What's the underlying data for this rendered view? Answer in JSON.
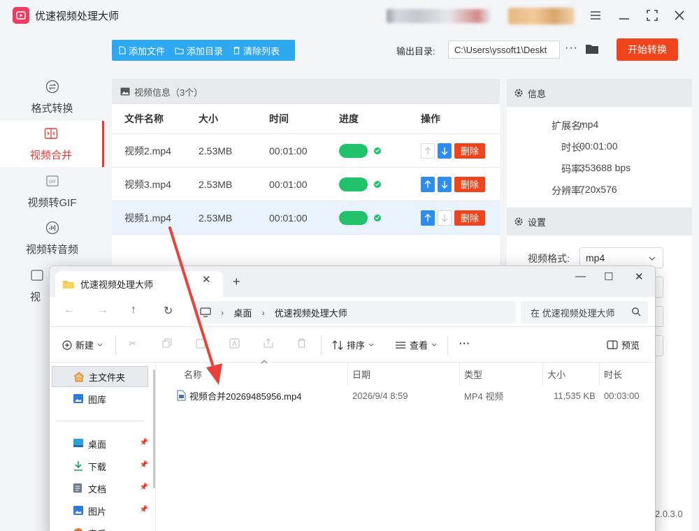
{
  "app": {
    "title": "优速视频处理大师",
    "version": "2.0.3.0"
  },
  "sidebar": {
    "items": [
      {
        "label": "格式转换",
        "icon": "format-convert-icon"
      },
      {
        "label": "视频合并",
        "icon": "video-merge-icon",
        "active": true
      },
      {
        "label": "视频转GIF",
        "icon": "gif-icon"
      },
      {
        "label": "视频转音频",
        "icon": "audio-icon"
      },
      {
        "label": "视",
        "icon": "video-icon"
      }
    ]
  },
  "toolbar": {
    "add_file": "添加文件",
    "add_dir": "添加目录",
    "clear_list": "清除列表",
    "output_label": "输出目录:",
    "output_path": "C:\\Users\\yssoft1\\Deskt",
    "more": "···",
    "start": "开始转换"
  },
  "file_panel": {
    "title": "视频信息（3个）",
    "columns": [
      "文件名称",
      "大小",
      "时间",
      "进度",
      "操作"
    ],
    "rows": [
      {
        "name": "视频2.mp4",
        "size": "2.53MB",
        "time": "00:01:00",
        "progress": 1.0,
        "delete": "删除"
      },
      {
        "name": "视频3.mp4",
        "size": "2.53MB",
        "time": "00:01:00",
        "progress": 1.0,
        "delete": "删除"
      },
      {
        "name": "视频1.mp4",
        "size": "2.53MB",
        "time": "00:01:00",
        "progress": 1.0,
        "delete": "删除"
      }
    ]
  },
  "info_panel": {
    "title": "信息",
    "fields": [
      {
        "key": "扩展名:",
        "value": "mp4"
      },
      {
        "key": "时长:",
        "value": "00:01:00"
      },
      {
        "key": "码率:",
        "value": "353688 bps"
      },
      {
        "key": "分辨率:",
        "value": "720x576"
      }
    ]
  },
  "settings_panel": {
    "title": "设置",
    "format_label": "视频格式:",
    "format_value": "mp4"
  },
  "explorer": {
    "tab_title": "优速视频处理大师",
    "breadcrumb": [
      "桌面",
      "优速视频处理大师"
    ],
    "search_placeholder": "在 优速视频处理大师",
    "commands": {
      "new": "新建",
      "sort": "排序",
      "view": "查看",
      "more": "···",
      "preview": "预览"
    },
    "nav_items": [
      {
        "label": "主文件夹",
        "selected": true
      },
      {
        "label": "图库"
      },
      {
        "label": "桌面"
      },
      {
        "label": "下载"
      },
      {
        "label": "文档"
      },
      {
        "label": "图片"
      },
      {
        "label": "音乐"
      }
    ],
    "columns": [
      "名称",
      "日期",
      "类型",
      "大小",
      "时长"
    ],
    "files": [
      {
        "name": "视频合并20269485956.mp4",
        "date": "2026/9/4 8:59",
        "type": "MP4 视频",
        "size": "11,535 KB",
        "duration": "00:03:00"
      }
    ]
  },
  "colors": {
    "accent_red": "#f0441c",
    "accent_blue": "#2ea8f0",
    "progress_green": "#21c36a",
    "active_nav": "#e53935"
  }
}
